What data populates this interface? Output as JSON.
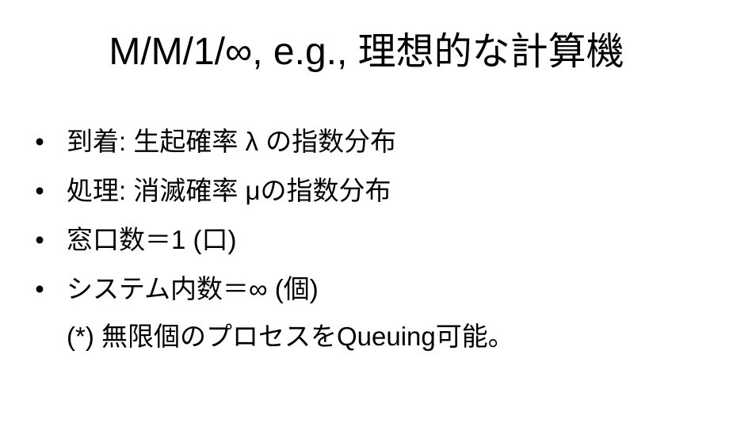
{
  "slide": {
    "title": "M/M/1/∞, e.g., 理想的な計算機",
    "bullet_symbol": "•",
    "bullets": [
      {
        "label": "到着: 生起確率 λ の指数分布"
      },
      {
        "label": "処理: 消滅確率 μの指数分布"
      },
      {
        "label": "窓口数＝1 (口)"
      },
      {
        "label": "システム内数＝∞ (個)"
      }
    ],
    "note": "(*) 無限個のプロセスをQueuing可能。"
  }
}
